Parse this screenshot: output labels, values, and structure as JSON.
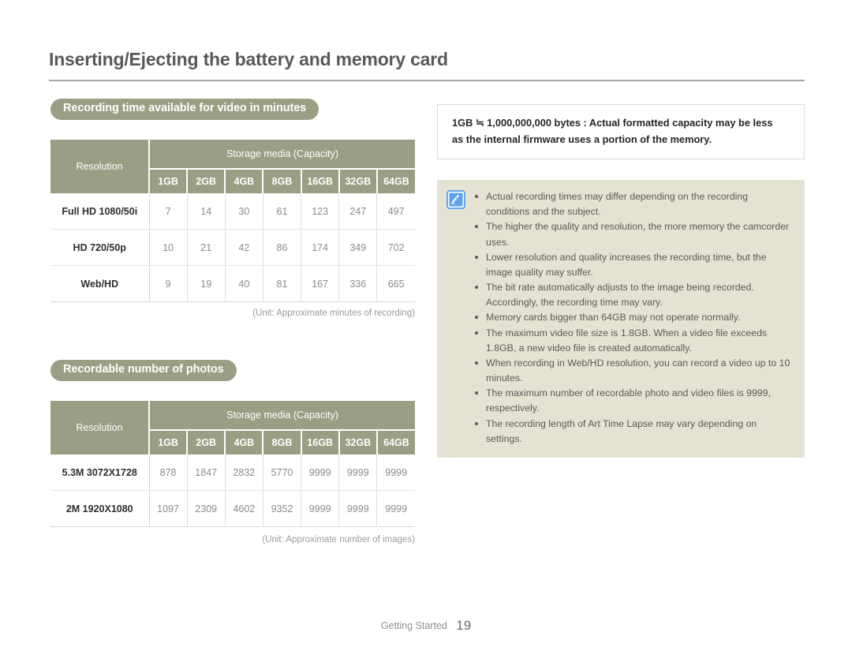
{
  "document": {
    "title": "Inserting/Ejecting the battery and memory card"
  },
  "sections": {
    "video": {
      "heading": "Recording time available for video in minutes",
      "unit_caption": "(Unit: Approximate minutes of recording)"
    },
    "photo": {
      "heading": "Recordable number of photos",
      "unit_caption": "(Unit: Approximate number of images)"
    }
  },
  "table_video": {
    "col_resolution": "Resolution",
    "col_storage_group": "Storage media (Capacity)",
    "capacities": [
      "1GB",
      "2GB",
      "4GB",
      "8GB",
      "16GB",
      "32GB",
      "64GB"
    ],
    "rows": [
      {
        "label": "Full HD 1080/50i",
        "values": [
          "7",
          "14",
          "30",
          "61",
          "123",
          "247",
          "497"
        ]
      },
      {
        "label": "HD 720/50p",
        "values": [
          "10",
          "21",
          "42",
          "86",
          "174",
          "349",
          "702"
        ]
      },
      {
        "label": "Web/HD",
        "values": [
          "9",
          "19",
          "40",
          "81",
          "167",
          "336",
          "665"
        ]
      }
    ]
  },
  "table_photo": {
    "col_resolution": "Resolution",
    "col_storage_group": "Storage media (Capacity)",
    "capacities": [
      "1GB",
      "2GB",
      "4GB",
      "8GB",
      "16GB",
      "32GB",
      "64GB"
    ],
    "rows": [
      {
        "label": "5.3M 3072X1728",
        "values": [
          "878",
          "1847",
          "2832",
          "5770",
          "9999",
          "9999",
          "9999"
        ]
      },
      {
        "label": "2M 1920X1080",
        "values": [
          "1097",
          "2309",
          "4602",
          "9352",
          "9999",
          "9999",
          "9999"
        ]
      }
    ]
  },
  "capacity_note": {
    "line1": "1GB ≒ 1,000,000,000 bytes : Actual formatted capacity may be less",
    "line2": "as the internal firmware uses a portion of the memory."
  },
  "notes": {
    "icon": "note-pen-icon",
    "items": [
      "Actual recording times may differ depending on the recording conditions and the subject.",
      "The higher the quality and resolution, the more memory the camcorder uses.",
      "Lower resolution and quality increases the recording time, but the image quality may suffer.",
      "The bit rate automatically adjusts to the image being recorded. Accordingly, the recording time may vary.",
      "Memory cards bigger than 64GB may not operate normally.",
      "The maximum video file size is 1.8GB. When a video file exceeds 1.8GB, a new video file is created automatically.",
      "When recording in Web/HD resolution, you can record a video up to 10 minutes.",
      "The maximum number of recordable photo and video files is 9999, respectively.",
      "The recording length of Art Time Lapse may vary depending on settings."
    ]
  },
  "footer": {
    "label": "Getting Started",
    "page_number": "19"
  },
  "colors": {
    "header_olive": "#9b9d84",
    "notes_background": "#e3e2d3",
    "icon_blue": "#4a90e2"
  }
}
